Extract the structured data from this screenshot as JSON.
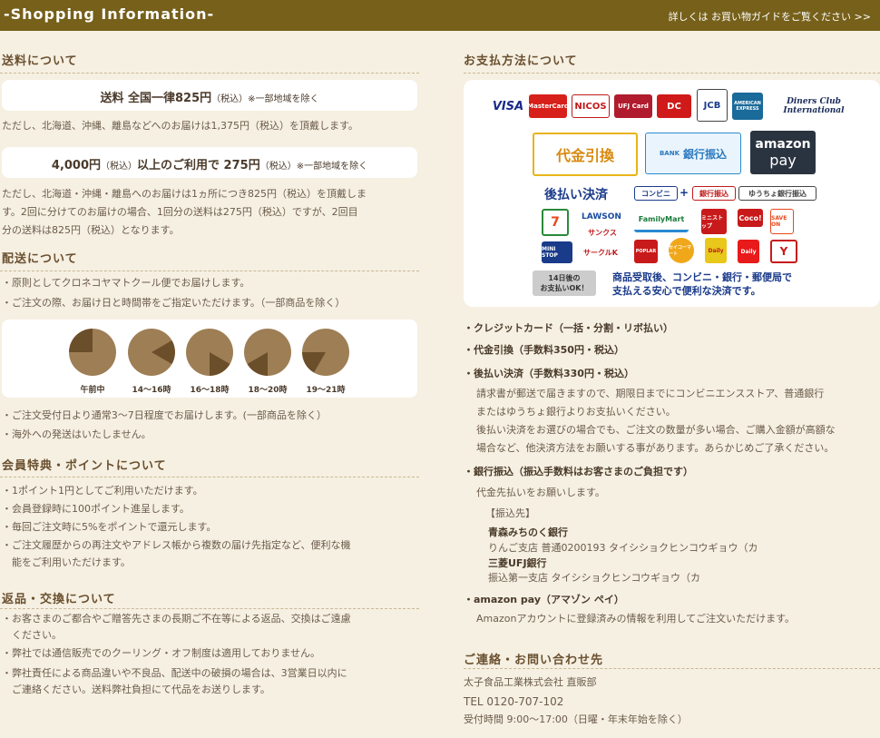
{
  "header": {
    "title": "-Shopping Information-",
    "guide_link": "詳しくは お買い物ガイドをご覧ください >>"
  },
  "shipping": {
    "title": "送料について",
    "box1_main": "送料 全国一律825円",
    "box1_tax": "（税込）",
    "box1_note": "※一部地域を除く",
    "note1": "ただし、北海道、沖縄、離島などへのお届けは1,375円（税込）を頂戴します。",
    "box2_main": "4,000円",
    "box2_tax1": "（税込）",
    "box2_mid": "以上のご利用で 275円",
    "box2_tax2": "（税込）",
    "box2_note": "※一部地域を除く",
    "note2_l1": "ただし、北海道・沖縄・離島へのお届けは1ヵ所につき825円（税込）を頂戴しま",
    "note2_l2": "す。2回に分けてのお届けの場合、1回分の送料は275円（税込）ですが、2回目",
    "note2_l3": "分の送料は825円（税込）となります。"
  },
  "delivery": {
    "title": "配送について",
    "items": [
      "・原則としてクロネコヤマトクール便でお届けします。",
      "・ご注文の際、お届け日と時間帯をご指定いただけます。（一部商品を除く）"
    ],
    "times": [
      "午前中",
      "14〜16時",
      "16〜18時",
      "18〜20時",
      "19〜21時"
    ],
    "items2": [
      "・ご注文受付日より通常3〜7日程度でお届けします。(一部商品を除く）",
      "・海外への発送はいたしません。"
    ]
  },
  "member": {
    "title": "会員特典・ポイントについて",
    "items": [
      "・1ポイント1円としてご利用いただけます。",
      "・会員登録時に100ポイント進呈します。",
      "・毎回ご注文時に5%をポイントで還元します。",
      "・ご注文履歴からの再注文やアドレス帳から複数の届け先指定など、便利な機",
      "　能をご利用いただけます。"
    ]
  },
  "returns": {
    "title": "返品・交換について",
    "items": [
      "・お客さまのご都合やご贈答先さまの長期ご不在等による返品、交換はご遠慮",
      "　ください。",
      "・弊社では通信販売でのクーリング・オフ制度は適用しておりません。",
      "・弊社責任による商品違いや不良品、配送中の破損の場合は、3営業日以内に",
      "　ご連絡ください。送料弊社負担にて代品をお送りします。"
    ]
  },
  "payment": {
    "title": "お支払方法について",
    "cards": [
      "VISA",
      "MasterCard",
      "NICOS",
      "UFJ Card",
      "DC",
      "JCB",
      "AMERICAN EXPRESS",
      "Diners Club International"
    ],
    "cod_label": "代金引換",
    "bank_label": "銀行振込",
    "bank_small": "BANK",
    "amazon_label": "amazon",
    "amazon_pay": "pay",
    "later_title": "後払い決済",
    "later_tags": [
      "コンビニ",
      "+",
      "銀行振込",
      "ゆうちょ銀行振込"
    ],
    "stores": [
      "7",
      "LAWSON",
      "FamilyMart",
      "ミニストップ",
      "Coco!",
      "サンクス",
      "POPLAR",
      "Daily",
      "SAVE ON",
      "MINI STOP",
      "サークルK",
      "セイコーマート",
      "Y"
    ],
    "ok_badge_l1": "14日後の",
    "ok_badge_l2": "お支払いOK！",
    "later_desc_l1": "商品受取後、コンビニ・銀行・郵便局で",
    "later_desc_l2": "支払える安心で便利な決済です。",
    "credit": "・クレジットカード（一括・分割・リボ払い）",
    "cod": "・代金引換（手数料350円・税込）",
    "later": "・後払い決済（手数料330円・税込）",
    "later_l1": "請求書が郵送で届きますので、期限日までにコンビニエンスストア、普通銀行",
    "later_l2": "またはゆうちょ銀行よりお支払いください。",
    "later_l3": "後払い決済をお選びの場合でも、ご注文の数量が多い場合、ご購入金額が高額な",
    "later_l4": "場合など、他決済方法をお願いする事があります。あらかじめご了承ください。",
    "bank": "・銀行振込（振込手数料はお客さまのご負担です）",
    "bank_l1": "代金先払いをお願いします。",
    "bank_dest": "【振込先】",
    "bank1_name": "青森みちのく銀行",
    "bank1_acct": "りんご支店 普通0200193 タイシショクヒンコウギョウ（カ",
    "bank2_name": "三菱UFJ銀行",
    "bank2_acct": "振込第一支店 タイシショクヒンコウギョウ（カ",
    "amazon": "・amazon pay（アマゾン ペイ）",
    "amazon_l1": "Amazonアカウントに登録済みの情報を利用してご注文いただけます。"
  },
  "contact": {
    "title": "ご連絡・お問い合わせ先",
    "company": "太子食品工業株式会社 直販部",
    "tel": "TEL 0120-707-102",
    "hours": "受付時間 9:00〜17:00（日曜・年末年始を除く）"
  }
}
